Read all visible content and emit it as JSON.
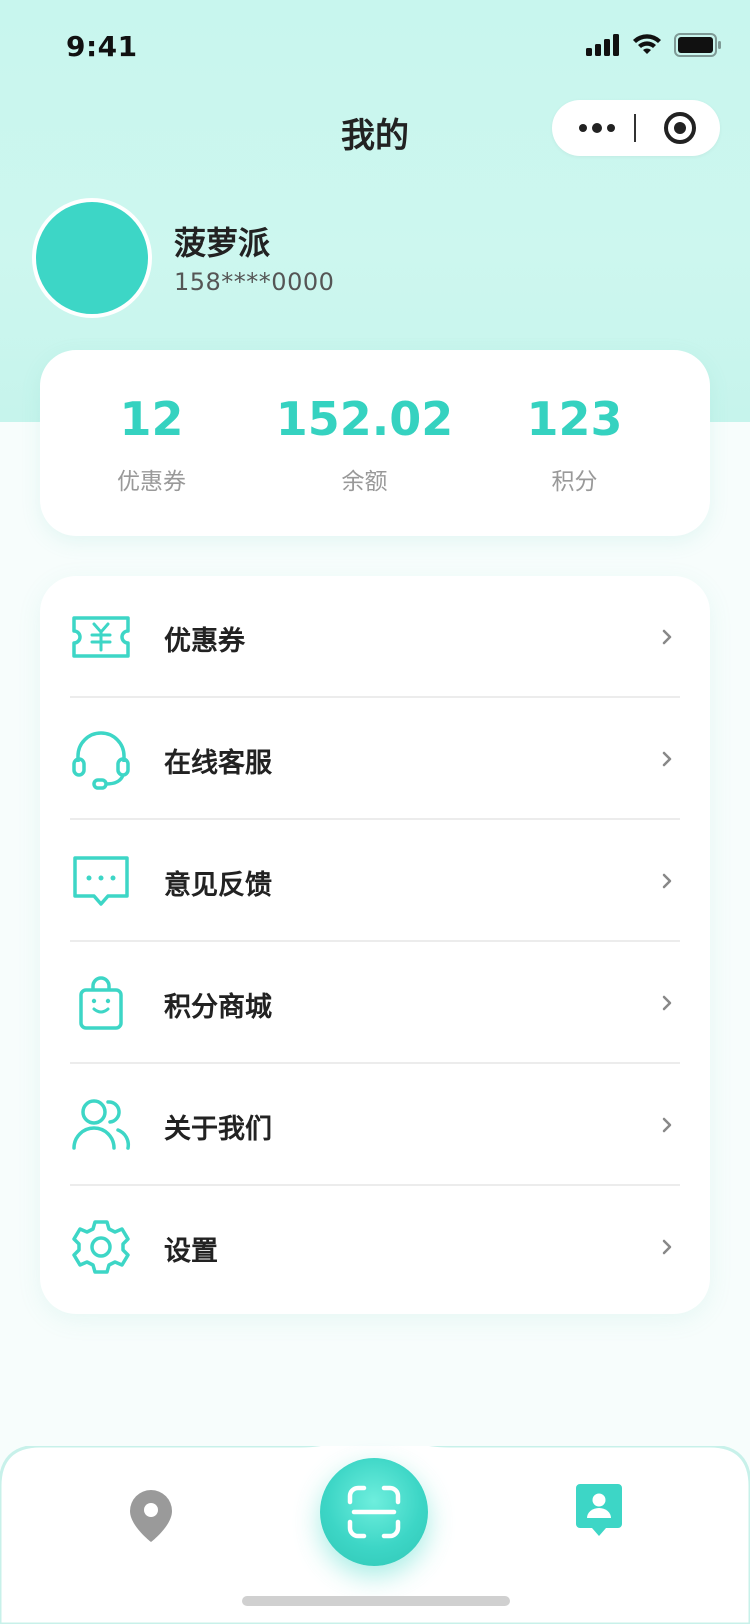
{
  "status_bar": {
    "time": "9:41"
  },
  "nav": {
    "title": "我的"
  },
  "profile": {
    "name": "菠萝派",
    "phone": "158****0000"
  },
  "stats": [
    {
      "value": "12",
      "label": "优惠券"
    },
    {
      "value": "152.02",
      "label": "余额"
    },
    {
      "value": "123",
      "label": "积分"
    }
  ],
  "menu": [
    {
      "label": "优惠券",
      "icon": "coupon-icon"
    },
    {
      "label": "在线客服",
      "icon": "headset-icon"
    },
    {
      "label": "意见反馈",
      "icon": "feedback-icon"
    },
    {
      "label": "积分商城",
      "icon": "shopping-bag-icon"
    },
    {
      "label": "关于我们",
      "icon": "users-icon"
    },
    {
      "label": "设置",
      "icon": "gear-icon"
    }
  ],
  "tabbar": {
    "left_icon": "location-pin-icon",
    "center_icon": "scan-icon",
    "right_icon": "profile-icon"
  },
  "colors": {
    "accent": "#3dd6c6",
    "header_bg": "#c8f6ee",
    "inactive": "#9a9a9a"
  }
}
